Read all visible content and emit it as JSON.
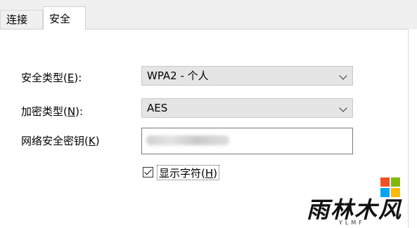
{
  "tabs": [
    {
      "label": "连接",
      "active": false
    },
    {
      "label": "安全",
      "active": true
    }
  ],
  "security_type": {
    "label": "安全类型",
    "accel": "E",
    "value": "WPA2 - 个人"
  },
  "encryption_type": {
    "label": "加密类型",
    "accel": "N",
    "value": "AES"
  },
  "network_key": {
    "label": "网络安全密钥",
    "accel": "K",
    "value_obscured": true
  },
  "show_chars": {
    "label": "显示字符",
    "accel": "H",
    "checked": true
  },
  "watermark": {
    "text": "雨林木风",
    "subtext": "YLMF"
  },
  "colors": {
    "red": "#f25022",
    "green": "#7fba00",
    "blue": "#00a4ef",
    "yellow": "#ffb900"
  }
}
